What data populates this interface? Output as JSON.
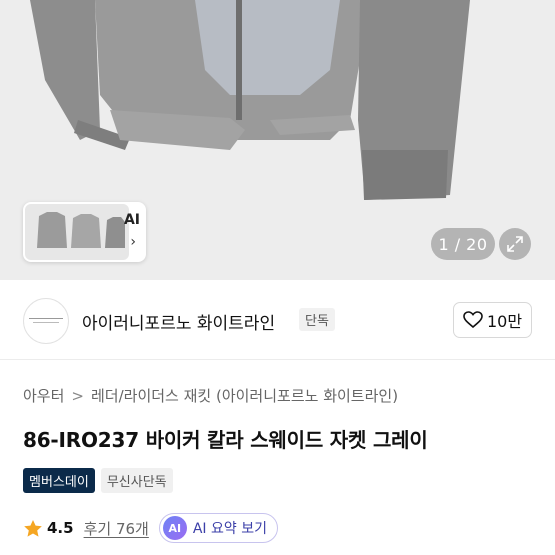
{
  "gallery": {
    "thumb_ai_label": "AI",
    "thumb_chevron": "›",
    "counter": "1 / 20",
    "expand_icon": "expand-icon"
  },
  "brand": {
    "name": "아이러니포르노 화이트라인",
    "badge": "단독",
    "like_count": "10만",
    "like_icon": "heart-icon"
  },
  "breadcrumb": {
    "items": [
      "아우터",
      "레더/라이더스 재킷 (아이러니포르노 화이트라인)"
    ],
    "separator": ">"
  },
  "product": {
    "title": "86-IRO237 바이커 칼라 스웨이드 자켓 그레이",
    "tags": [
      "멤버스데이",
      "무신사단독"
    ]
  },
  "rating": {
    "value": "4.5",
    "reviews": "후기 76개",
    "ai_badge": "AI",
    "ai_summary": "AI 요약 보기",
    "star_color": "#f5a623"
  },
  "colors": {
    "member_tag_bg": "#0b2a4a",
    "ai_accent": "#6e83f5"
  }
}
